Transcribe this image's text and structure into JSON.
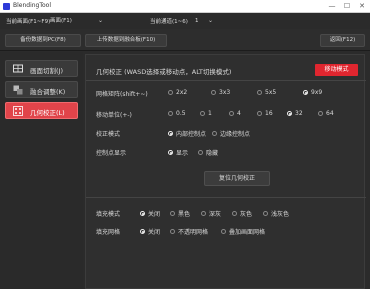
{
  "window": {
    "title": "BlendingTool",
    "minimize": "—",
    "maximize": "☐",
    "close": "✕"
  },
  "screen_row": {
    "current_screen_label": "当前画面(F1~F9)",
    "current_screen_value": "画面(F1)",
    "current_channel_label": "当前通道(1~6)",
    "current_channel_value": "1"
  },
  "toolbar": {
    "backup_label": "备份数据到PC(F8)",
    "upload_label": "上传数据到融合板(F10)",
    "back_label": "返回(F12)"
  },
  "sidebar": {
    "items": [
      {
        "label": "画面切割(J)",
        "icon": "screen-cut-icon",
        "active": false
      },
      {
        "label": "融合调整(K)",
        "icon": "blend-adjust-icon",
        "active": false
      },
      {
        "label": "几何校正(L)",
        "icon": "geometry-correct-icon",
        "active": true
      }
    ]
  },
  "main": {
    "header": "几何校正 (WASD选择或移动点，ALT切换模式)",
    "mode_badge": "移动模式",
    "grid_label": "网格矩阵(shift+~)",
    "grid_options": [
      "2x2",
      "3x3",
      "5x5",
      "9x9"
    ],
    "grid_selected": "9x9",
    "step_label": "移动单位(+-)",
    "step_options": [
      "0.5",
      "1",
      "4",
      "16",
      "32",
      "64"
    ],
    "step_selected": "32",
    "correction_label": "校正模式",
    "correction_options": [
      "内部控制点",
      "边缘控制点"
    ],
    "correction_selected": "内部控制点",
    "display_label": "控制点显示",
    "display_options": [
      "显示",
      "隐藏"
    ],
    "display_selected": "显示",
    "reset_label": "复位几何校正",
    "fill_mode_label": "填充模式",
    "fill_mode_options": [
      "关闭",
      "黑色",
      "深灰",
      "灰色",
      "浅灰色"
    ],
    "fill_mode_selected": "关闭",
    "fill_grid_label": "填充网格",
    "fill_grid_options": [
      "关闭",
      "不透明网格",
      "叠加画面网格"
    ],
    "fill_grid_selected": "关闭"
  },
  "colors": {
    "accent_red": "#e0262f",
    "active_nav": "#e1444a",
    "background": "#2b2b2b"
  }
}
